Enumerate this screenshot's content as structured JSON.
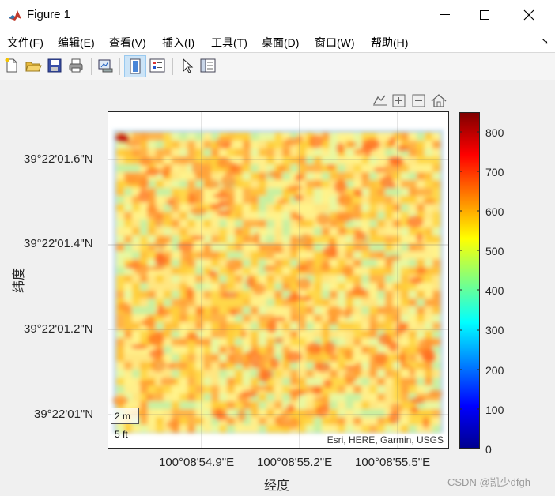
{
  "window": {
    "title": "Figure 1"
  },
  "menu": [
    "文件(F)",
    "编辑(E)",
    "查看(V)",
    "插入(I)",
    "工具(T)",
    "桌面(D)",
    "窗口(W)",
    "帮助(H)"
  ],
  "toolbar_icons": [
    "new-figure-icon",
    "open-icon",
    "save-icon",
    "print-icon",
    "link-plot-icon",
    "colorbar-toggle-icon",
    "legend-toggle-icon",
    "pointer-icon",
    "property-inspector-icon"
  ],
  "axes": {
    "y_ticks": [
      "39°22'01.6\"N",
      "39°22'01.4\"N",
      "39°22'01.2\"N",
      "39°22'01\"N"
    ],
    "x_ticks": [
      "100°08'54.9\"E",
      "100°08'55.2\"E",
      "100°08'55.5\"E"
    ],
    "ylabel": "纬度",
    "xlabel": "经度"
  },
  "colorbar": {
    "ticks": [
      "0",
      "100",
      "200",
      "300",
      "400",
      "500",
      "600",
      "700",
      "800"
    ],
    "range": [
      0,
      850
    ]
  },
  "map": {
    "scale_m": "2 m",
    "scale_ft": "5 ft",
    "attribution": "Esri, HERE, Garmin, USGS"
  },
  "watermark": "CSDN @凯少dfgh"
}
